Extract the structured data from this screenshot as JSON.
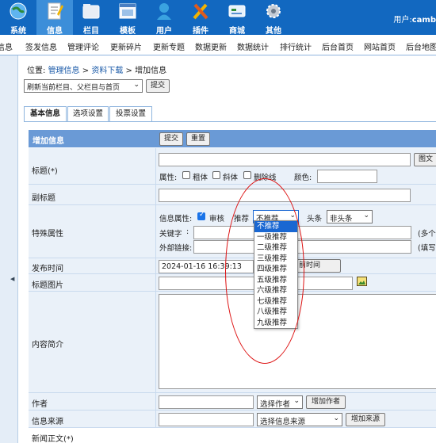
{
  "topnav": {
    "items": [
      {
        "label": "系统",
        "icon": "globe-icon"
      },
      {
        "label": "信息",
        "icon": "document-icon"
      },
      {
        "label": "栏目",
        "icon": "folder-icon"
      },
      {
        "label": "模板",
        "icon": "template-icon"
      },
      {
        "label": "用户",
        "icon": "user-icon"
      },
      {
        "label": "插件",
        "icon": "tools-icon"
      },
      {
        "label": "商城",
        "icon": "shop-icon"
      },
      {
        "label": "其他",
        "icon": "gear-icon"
      }
    ],
    "active": "信息",
    "user_prefix": "用户:",
    "user_name": "camb",
    "colors": {
      "bar": "#1268c0",
      "active": "#3c8ed9",
      "header_row": "#6a9ad6",
      "row_bg": "#eaf1f9"
    }
  },
  "subnav": [
    "信息",
    "签发信息",
    "管理评论",
    "更新碎片",
    "更新专题",
    "数据更新",
    "数据统计",
    "排行统计",
    "后台首页",
    "网站首页",
    "后台地图"
  ],
  "breadcrumb": {
    "prefix": "位置:",
    "items": [
      "管理信息",
      "资料下载",
      "增加信息"
    ],
    "sep": ">"
  },
  "refresh_select": "刷新当前栏目、父栏目与首页",
  "refresh_submit": "提交",
  "tabs": [
    "基本信息",
    "选项设置",
    "投票设置"
  ],
  "form": {
    "header": "增加信息",
    "submit": "提交",
    "reset": "重置",
    "title_label": "标题(*)",
    "title_value": "",
    "pic_button": "图文",
    "attr_label": "属性:",
    "bold_label": "粗体",
    "italic_label": "斜体",
    "strike_label": "删除线",
    "color_label": "颜色:",
    "subtitle_label": "副标题",
    "special_label": "特殊属性",
    "info_attr_label": "信息属性:",
    "audit_label": "审核",
    "audit_checked": true,
    "recommend_label": "推荐",
    "recommend_value": "不推荐",
    "headline_label": "头条",
    "headline_value": "非头条",
    "keyword_label": "关键字",
    "keyword_hint": "(多个",
    "link_label": "外部链接:",
    "link_hint": "(填写",
    "time_label": "发布时间",
    "time_value": "2024-01-16 16:39:13",
    "set_now_button": "设为当前时间",
    "image_label": "标题图片",
    "intro_label": "内容简介",
    "author_label": "作者",
    "author_select": "选择作者",
    "add_author_button": "增加作者",
    "source_label": "信息来源",
    "source_select": "选择信息来源",
    "add_source_button": "增加来源",
    "body_label": "新闻正文(*)"
  },
  "recommend_options": [
    "不推荐",
    "一级推荐",
    "二级推荐",
    "三级推荐",
    "四级推荐",
    "五级推荐",
    "六级推荐",
    "七级推荐",
    "八级推荐",
    "九级推荐"
  ]
}
